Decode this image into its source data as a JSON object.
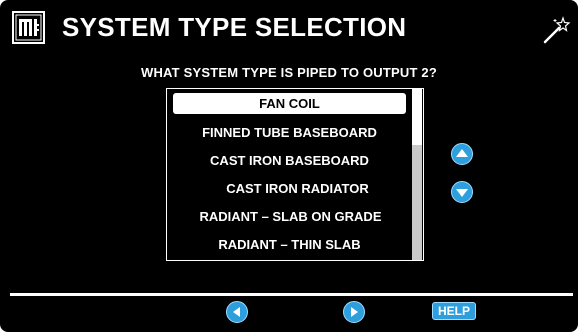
{
  "header": {
    "title": "SYSTEM TYPE SELECTION",
    "logo_icon": "logo-icon",
    "wand_icon": "magic-wand-icon"
  },
  "question": "WHAT SYSTEM TYPE IS PIPED TO OUTPUT 2?",
  "system_list": {
    "selected_index": 0,
    "items": [
      "FAN COIL",
      "FINNED TUBE BASEBOARD",
      "CAST IRON BASEBOARD",
      "CAST IRON RADIATOR",
      "RADIANT – SLAB ON GRADE",
      "RADIANT – THIN SLAB"
    ]
  },
  "footer": {
    "help_label": "HELP"
  },
  "colors": {
    "background": "#000000",
    "text": "#ffffff",
    "accent": "#2e9fdc",
    "selection_bg": "#ffffff"
  }
}
